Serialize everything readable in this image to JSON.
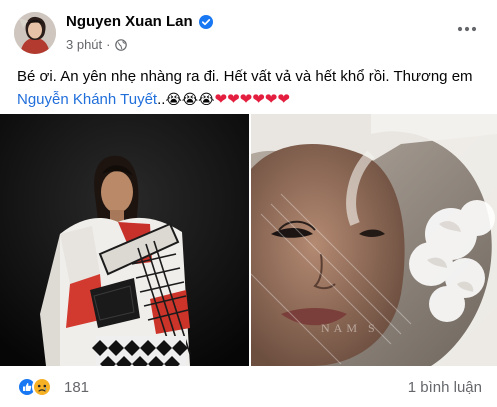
{
  "post": {
    "author": "Nguyen Xuan Lan",
    "time": "3 phút",
    "text_line1": "Bé ơi. An yên nhẹ nhàng ra đi. Hết vất vả và hết khổ rồi. Thương em",
    "mention": "Nguyễn Khánh Tuyết",
    "text_suffix": "..",
    "crying_emojis": "😭😭😭",
    "hearts": "❤❤❤❤❤❤"
  },
  "photo_right_watermark": "NAM S",
  "footer": {
    "reaction_count": "181",
    "comment_count": "1 bình luận"
  },
  "colors": {
    "accent": "#1877f2",
    "mention": "#216fdb",
    "heart": "#e41e3f",
    "muted": "#65676b"
  },
  "icons": [
    "verified-icon",
    "globe-icon",
    "more-options-icon",
    "like-reaction-icon",
    "sad-reaction-icon"
  ]
}
